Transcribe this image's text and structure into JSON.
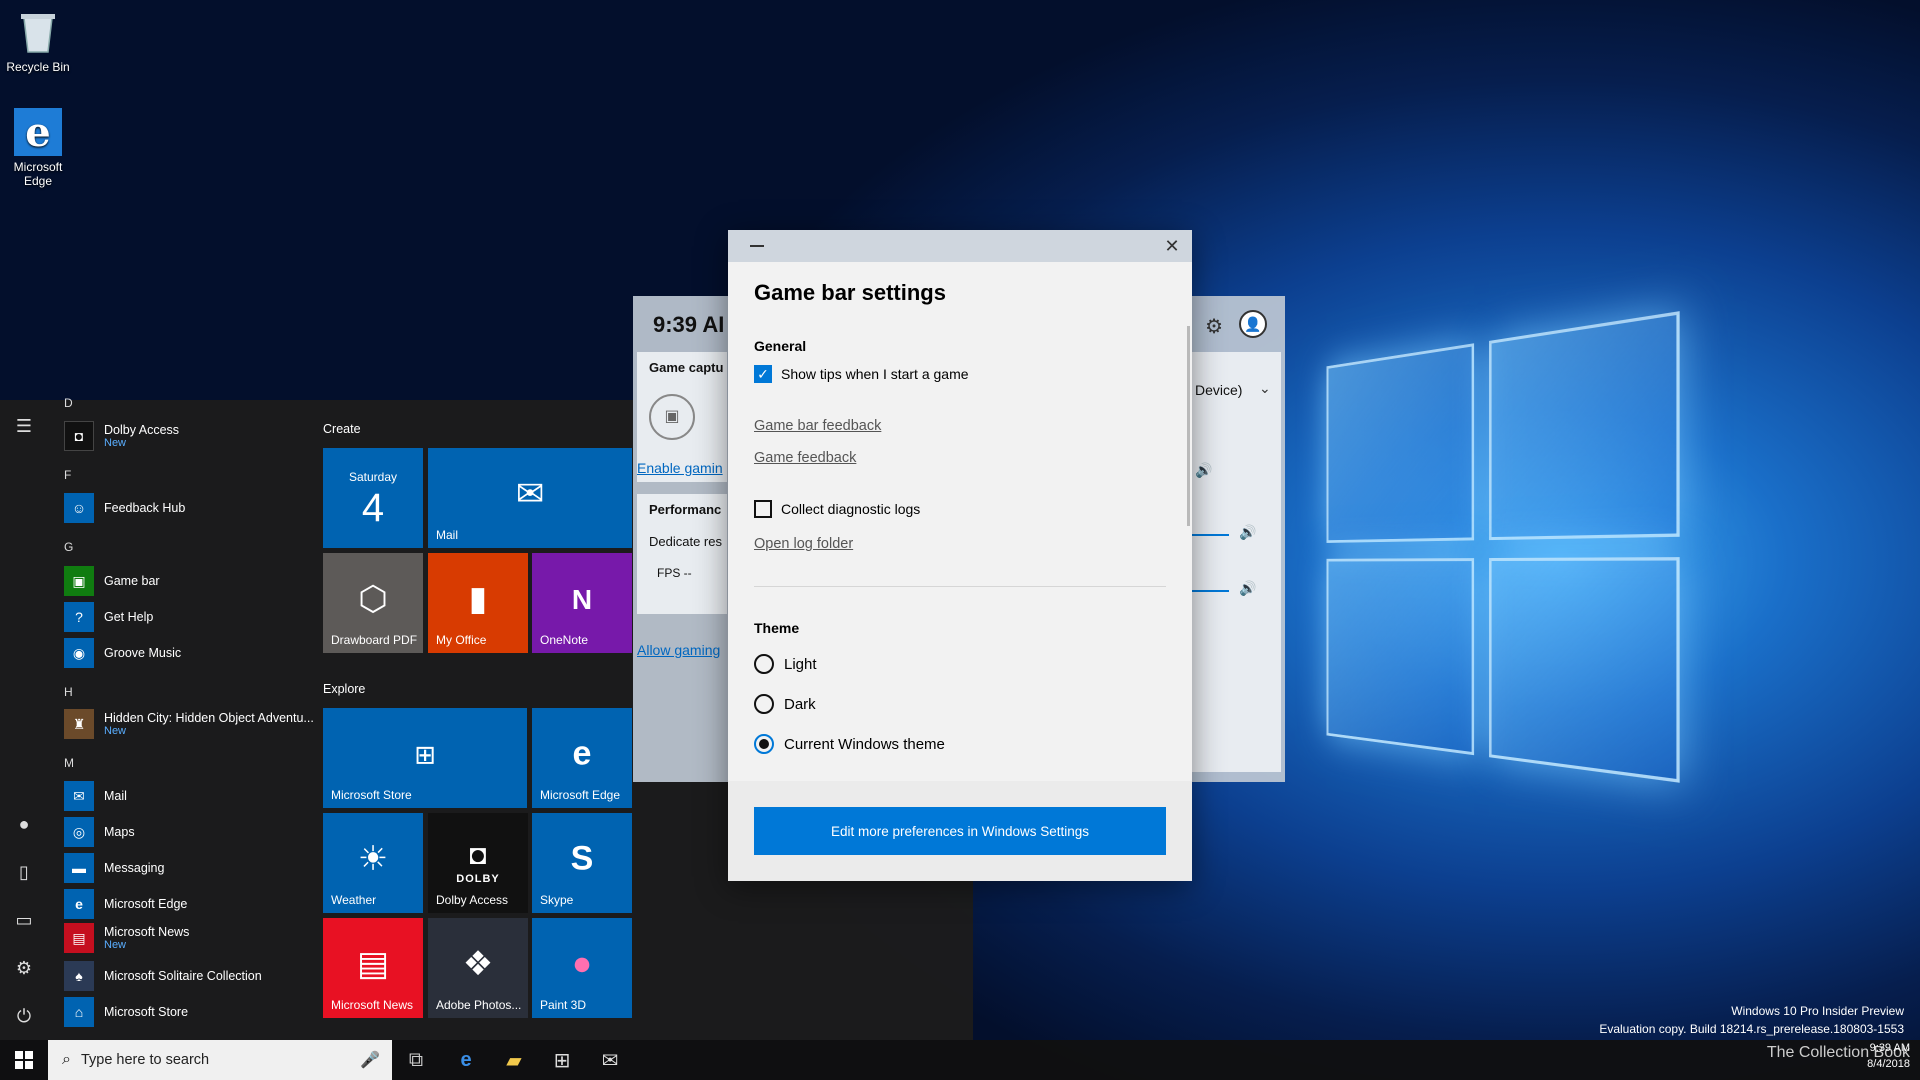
{
  "desktop": {
    "icons": [
      {
        "label": "Recycle Bin"
      },
      {
        "label": "Microsoft Edge"
      }
    ]
  },
  "start_menu": {
    "apps": [
      {
        "letter": "D"
      },
      {
        "name": "Dolby Access",
        "sub": "New"
      },
      {
        "letter": "F"
      },
      {
        "name": "Feedback Hub"
      },
      {
        "letter": "G"
      },
      {
        "name": "Game bar"
      },
      {
        "name": "Get Help"
      },
      {
        "name": "Groove Music"
      },
      {
        "letter": "H"
      },
      {
        "name": "Hidden City: Hidden Object Adventu...",
        "sub": "New"
      },
      {
        "letter": "M"
      },
      {
        "name": "Mail"
      },
      {
        "name": "Maps"
      },
      {
        "name": "Messaging"
      },
      {
        "name": "Microsoft Edge"
      },
      {
        "name": "Microsoft News",
        "sub": "New"
      },
      {
        "name": "Microsoft Solitaire Collection"
      },
      {
        "name": "Microsoft Store"
      }
    ],
    "groups": {
      "create": "Create",
      "explore": "Explore"
    },
    "tiles": {
      "calendar_day": "Saturday",
      "calendar_date": "4",
      "mail": "Mail",
      "drawboard": "Drawboard PDF",
      "my_office": "My Office",
      "onenote": "OneNote",
      "store": "Microsoft Store",
      "edge": "Microsoft Edge",
      "weather": "Weather",
      "dolby": "Dolby Access",
      "dolby_logo": "DOLBY",
      "skype": "Skype",
      "news": "Microsoft News",
      "adobe": "Adobe Photos...",
      "paint3d": "Paint 3D"
    }
  },
  "gamebar": {
    "time": "9:39 AI",
    "capture_title": "Game captu",
    "enable_link": "Enable gamin",
    "perf_title": "Performanc",
    "dedicate": "Dedicate res",
    "fps": "FPS --",
    "allow_link": "Allow gaming",
    "device": "Device)"
  },
  "dialog": {
    "title": "Game bar settings",
    "general_heading": "General",
    "show_tips": "Show tips when I start a game",
    "show_tips_checked": true,
    "gamebar_feedback": "Game bar feedback",
    "game_feedback": "Game feedback",
    "collect_logs": "Collect diagnostic logs",
    "collect_logs_checked": false,
    "open_log_folder": "Open log folder",
    "theme_heading": "Theme",
    "theme_options": [
      "Light",
      "Dark",
      "Current Windows theme"
    ],
    "theme_selected": "Current Windows theme",
    "prefs_button": "Edit more preferences in Windows Settings"
  },
  "taskbar": {
    "search_placeholder": "Type here to search"
  },
  "watermark": {
    "line1": "Windows 10 Pro Insider Preview",
    "line2": "Evaluation copy. Build 18214.rs_prerelease.180803-1553"
  },
  "tray": {
    "time": "9:39 AM",
    "date": "8/4/2018",
    "brand": "The Collection Book"
  },
  "colors": {
    "accent": "#0078d7",
    "tile_blue": "#0063b1",
    "tile_orange": "#d83b01",
    "tile_purple": "#7719aa",
    "tile_red": "#e81123",
    "tile_gray": "#5d5a58"
  }
}
